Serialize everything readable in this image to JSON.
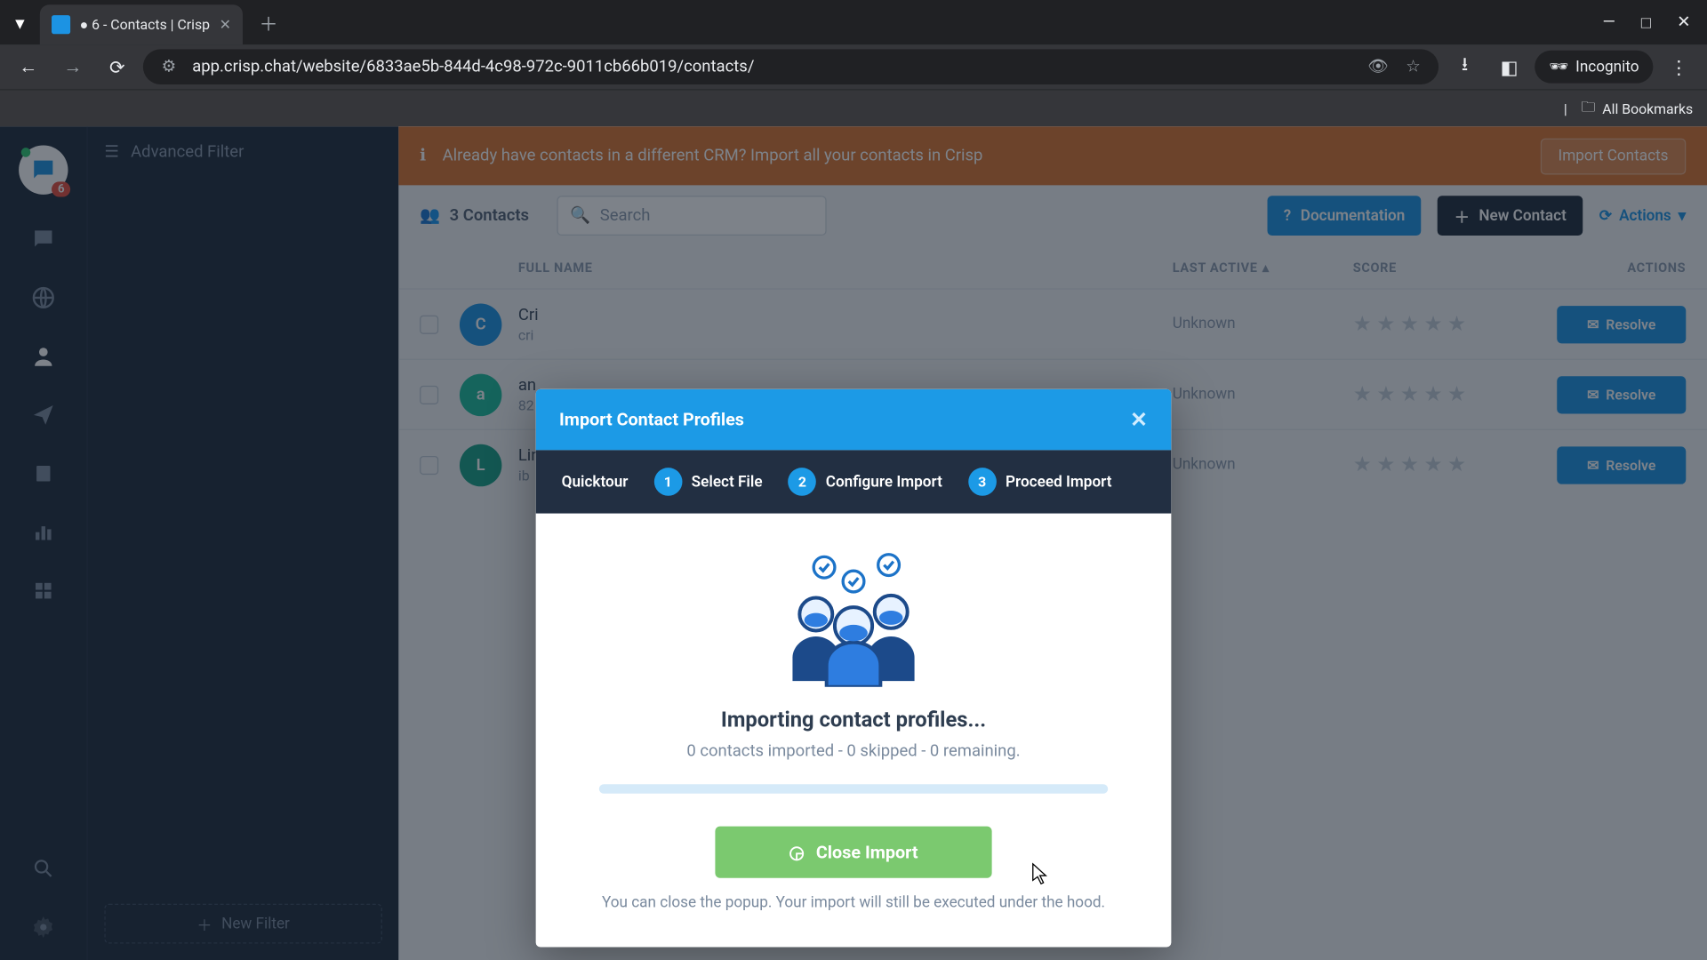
{
  "browser": {
    "tab_title": "● 6 - Contacts | Crisp",
    "url": "app.crisp.chat/website/6833ae5b-844d-4c98-972c-9011cb66b019/contacts/",
    "incognito": "Incognito",
    "all_bookmarks": "All Bookmarks"
  },
  "rail": {
    "badge": "6"
  },
  "side": {
    "filter_label": "Advanced Filter",
    "new_filter": "New Filter"
  },
  "banner": {
    "text": "Already have contacts in a different CRM? Import all your contacts in Crisp",
    "button": "Import Contacts"
  },
  "toolbar": {
    "count": "3 Contacts",
    "search_placeholder": "Search",
    "documentation": "Documentation",
    "new_contact": "New Contact",
    "actions": "Actions"
  },
  "table": {
    "headers": {
      "full_name": "FULL NAME",
      "last_active": "LAST ACTIVE",
      "score": "SCORE",
      "actions": "ACTIONS"
    },
    "rows": [
      {
        "name": "Cri",
        "sub": "cri",
        "last": "Unknown",
        "btn": "Resolve"
      },
      {
        "name": "an",
        "sub": "82",
        "last": "Unknown",
        "btn": "Resolve"
      },
      {
        "name": "Lin",
        "sub": "ib",
        "last": "Unknown",
        "btn": "Resolve"
      }
    ]
  },
  "modal": {
    "title": "Import Contact Profiles",
    "quicktour": "Quicktour",
    "steps": [
      {
        "num": "1",
        "label": "Select File"
      },
      {
        "num": "2",
        "label": "Configure Import"
      },
      {
        "num": "3",
        "label": "Proceed Import"
      }
    ],
    "importing_title": "Importing contact profiles...",
    "status": "0 contacts imported - 0 skipped - 0 remaining.",
    "close_btn": "Close Import",
    "hint": "You can close the popup. Your import will still be executed under the hood."
  }
}
